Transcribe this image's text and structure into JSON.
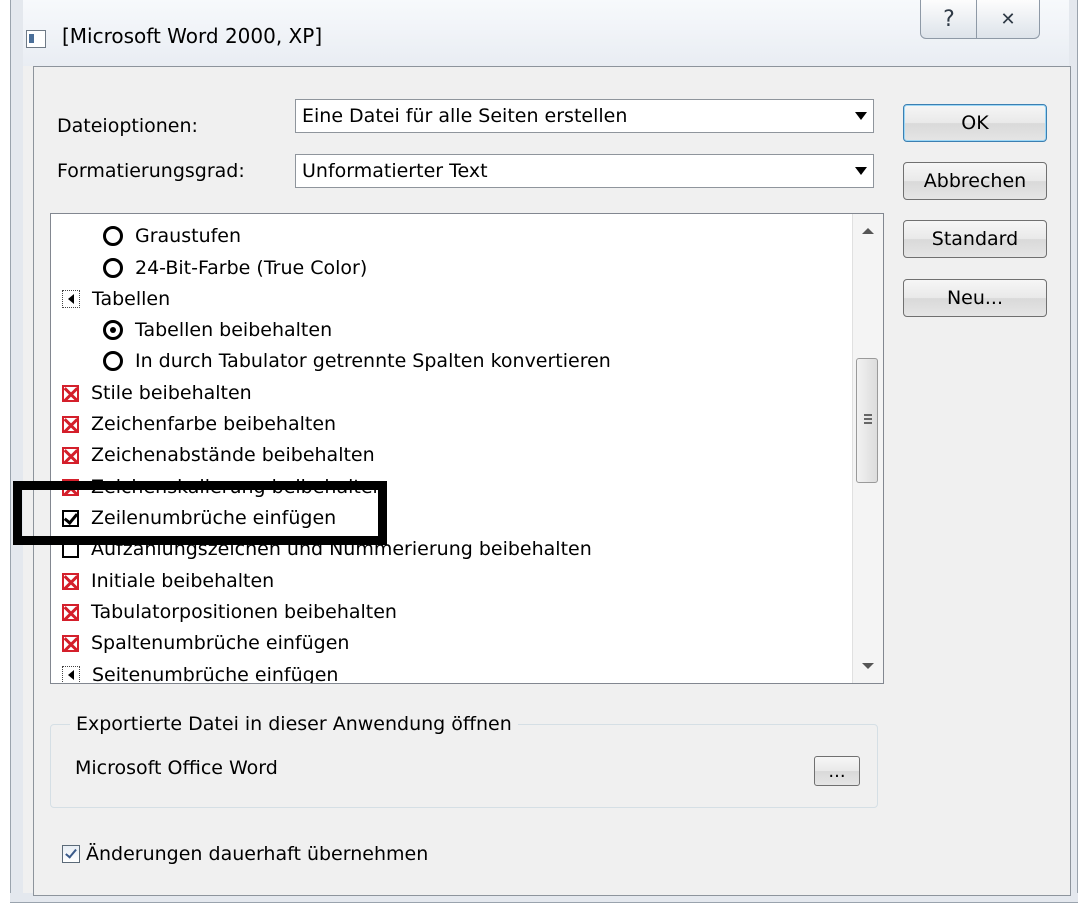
{
  "window": {
    "title": "[Microsoft Word 2000, XP]",
    "help_glyph": "?",
    "close_glyph": "✕"
  },
  "options": {
    "file_label": "Dateioptionen:",
    "file_value": "Eine Datei für alle Seiten erstellen",
    "format_label": "Formatierungsgrad:",
    "format_value": "Unformatierter Text"
  },
  "buttons": {
    "ok": "OK",
    "cancel": "Abbrechen",
    "standard": "Standard",
    "new": "Neu..."
  },
  "list": {
    "items": [
      {
        "label": "Graustufen",
        "control": "radio",
        "checked": false
      },
      {
        "label": "24-Bit-Farbe (True Color)",
        "control": "radio",
        "checked": false
      },
      {
        "label": "Tabellen",
        "control": "expander"
      },
      {
        "label": "Tabellen beibehalten",
        "control": "radio",
        "checked": true
      },
      {
        "label": "In durch Tabulator getrennte Spalten konvertieren",
        "control": "radio",
        "checked": false
      },
      {
        "label": "Stile beibehalten",
        "control": "checkbox-x"
      },
      {
        "label": "Zeichenfarbe beibehalten",
        "control": "checkbox-x"
      },
      {
        "label": "Zeichenabstände beibehalten",
        "control": "checkbox-x"
      },
      {
        "label": "Zeichenskalierung beibehalten",
        "control": "checkbox-x"
      },
      {
        "label": "Zeilenumbrüche einfügen",
        "control": "checkbox-checked"
      },
      {
        "label": "Aufzählungszeichen und Nummerierung beibehalten",
        "control": "checkbox"
      },
      {
        "label": "Initiale beibehalten",
        "control": "checkbox-x"
      },
      {
        "label": "Tabulatorpositionen beibehalten",
        "control": "checkbox-x"
      },
      {
        "label": "Spaltenumbrüche einfügen",
        "control": "checkbox-x"
      },
      {
        "label": "Seitenumbrüche einfügen",
        "control": "expander"
      }
    ]
  },
  "export": {
    "group_title": "Exportierte Datei in dieser Anwendung öffnen",
    "app_name": "Microsoft Office Word",
    "browse_label": "..."
  },
  "persist": {
    "label": "Änderungen dauerhaft übernehmen",
    "checked": true
  }
}
